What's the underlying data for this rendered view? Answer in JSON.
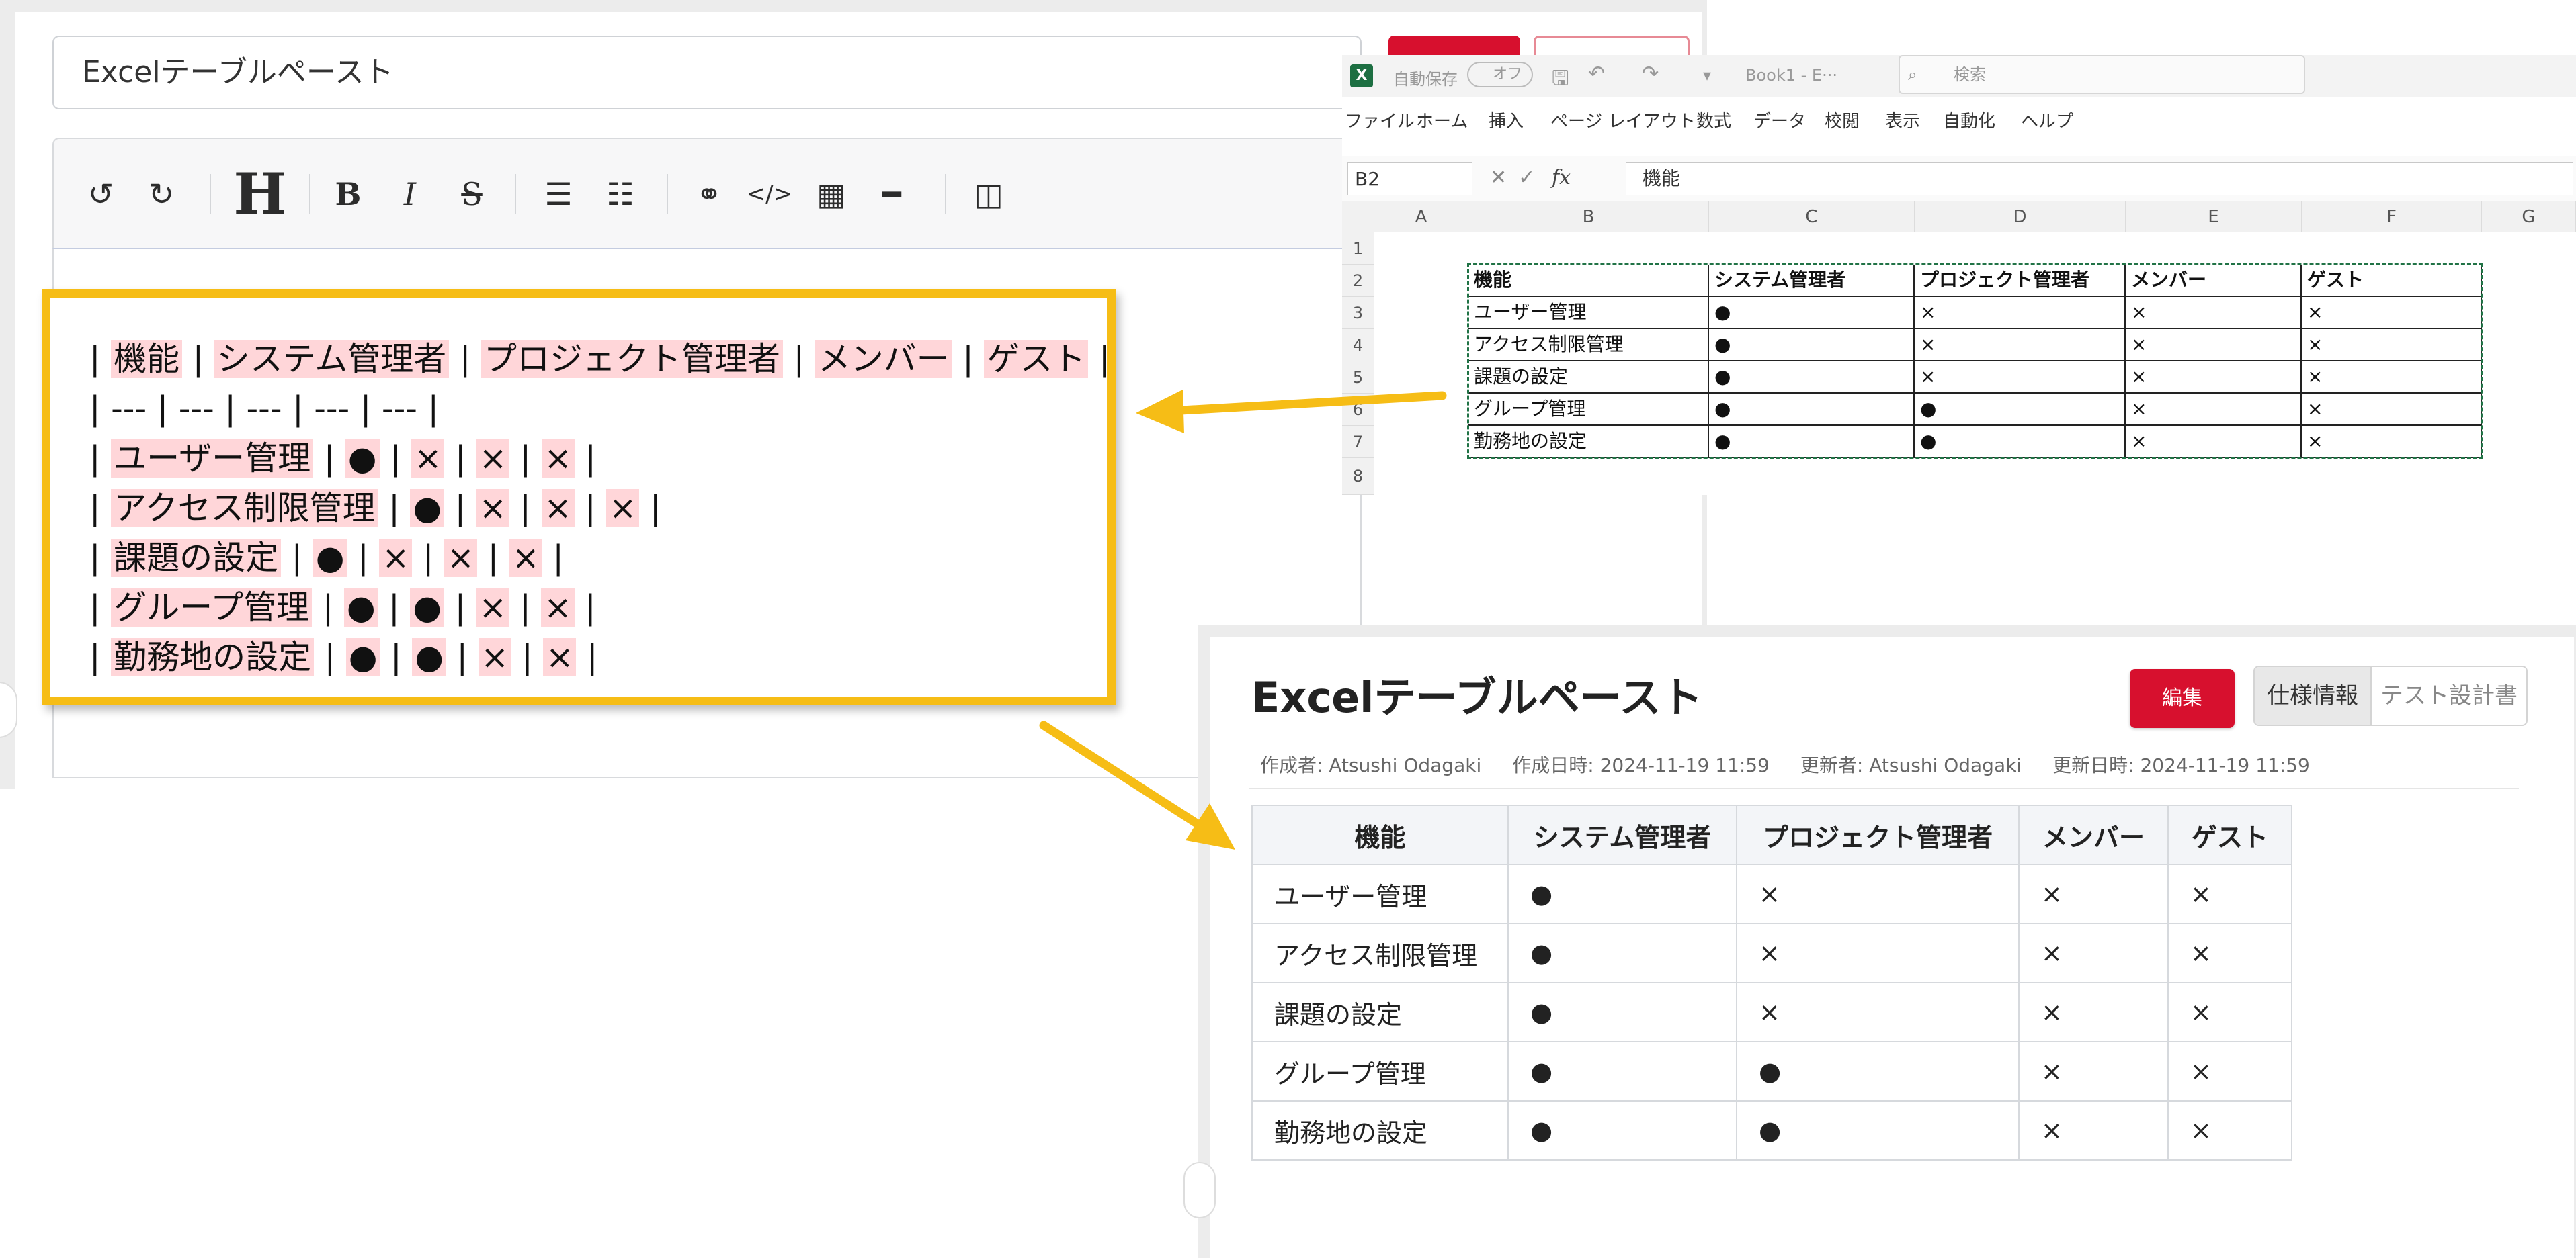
{
  "editor": {
    "title_value": "Excelテーブルペースト",
    "toolbar_icons": [
      "undo-icon",
      "redo-icon",
      "heading-icon",
      "bold-icon",
      "italic-icon",
      "strikethrough-icon",
      "bulleted-list-icon",
      "numbered-list-icon",
      "link-icon",
      "code-icon",
      "table-icon",
      "horizontal-rule-icon",
      "split-view-icon"
    ],
    "toolbar_glyphs": {
      "heading": "H",
      "bold": "B",
      "italic": "I",
      "strike": "S"
    },
    "markdown_lines": [
      [
        "| ",
        "機能",
        " | ",
        "システム管理者",
        " | ",
        "プロジェクト管理者",
        " | ",
        "メンバー",
        " | ",
        "ゲスト",
        " |"
      ],
      [
        "| --- | --- | --- | --- | --- |"
      ],
      [
        "| ",
        "ユーザー管理",
        " | ",
        "●",
        " | ",
        "×",
        " | ",
        "×",
        " | ",
        "×",
        " |"
      ],
      [
        "| ",
        "アクセス制限管理",
        " | ",
        "●",
        " | ",
        "×",
        " | ",
        "×",
        " | ",
        "×",
        " |"
      ],
      [
        "| ",
        "課題の設定",
        " | ",
        "●",
        " | ",
        "×",
        " | ",
        "×",
        " | ",
        "×",
        " |"
      ],
      [
        "| ",
        "グループ管理",
        " | ",
        "●",
        " | ",
        "●",
        " | ",
        "×",
        " | ",
        "×",
        " |"
      ],
      [
        "| ",
        "勤務地の設定",
        " | ",
        "●",
        " | ",
        "●",
        " | ",
        "×",
        " | ",
        "×",
        " |"
      ]
    ]
  },
  "excel": {
    "autosave_label": "自動保存",
    "autosave_state": "オフ",
    "filename": "Book1 - E···",
    "search_placeholder": "検索",
    "menu": [
      "ファイル",
      "ホーム",
      "挿入",
      "ページ レイアウト",
      "数式",
      "データ",
      "校閲",
      "表示",
      "自動化",
      "ヘルプ"
    ],
    "name_box": "B2",
    "fx": "fx",
    "formula_value": "機能",
    "columns": [
      "A",
      "B",
      "C",
      "D",
      "E",
      "F",
      "G"
    ],
    "rows": [
      "1",
      "2",
      "3",
      "4",
      "5",
      "6",
      "7",
      "8"
    ],
    "table": [
      [
        "機能",
        "システム管理者",
        "プロジェクト管理者",
        "メンバー",
        "ゲスト"
      ],
      [
        "ユーザー管理",
        "●",
        "×",
        "×",
        "×"
      ],
      [
        "アクセス制限管理",
        "●",
        "×",
        "×",
        "×"
      ],
      [
        "課題の設定",
        "●",
        "×",
        "×",
        "×"
      ],
      [
        "グループ管理",
        "●",
        "●",
        "×",
        "×"
      ],
      [
        "勤務地の設定",
        "●",
        "●",
        "×",
        "×"
      ]
    ]
  },
  "result": {
    "title": "Excelテーブルペースト",
    "edit_button": "編集",
    "tabs": [
      "仕様情報",
      "テスト設計書"
    ],
    "active_tab": 0,
    "meta": {
      "created_by": "作成者: Atsushi Odagaki",
      "created_at": "作成日時: 2024-11-19 11:59",
      "updated_by": "更新者: Atsushi Odagaki",
      "updated_at": "更新日時: 2024-11-19 11:59"
    },
    "table": {
      "headers": [
        "機能",
        "システム管理者",
        "プロジェクト管理者",
        "メンバー",
        "ゲスト"
      ],
      "rows": [
        [
          "ユーザー管理",
          "●",
          "×",
          "×",
          "×"
        ],
        [
          "アクセス制限管理",
          "●",
          "×",
          "×",
          "×"
        ],
        [
          "課題の設定",
          "●",
          "×",
          "×",
          "×"
        ],
        [
          "グループ管理",
          "●",
          "●",
          "×",
          "×"
        ],
        [
          "勤務地の設定",
          "●",
          "●",
          "×",
          "×"
        ]
      ]
    }
  },
  "colors": {
    "highlight_box": "#f6bd16",
    "arrow": "#f6bd16",
    "primary_red": "#d7102e",
    "excel_green": "#217346",
    "markdown_highlight": "#ffd6d9"
  }
}
